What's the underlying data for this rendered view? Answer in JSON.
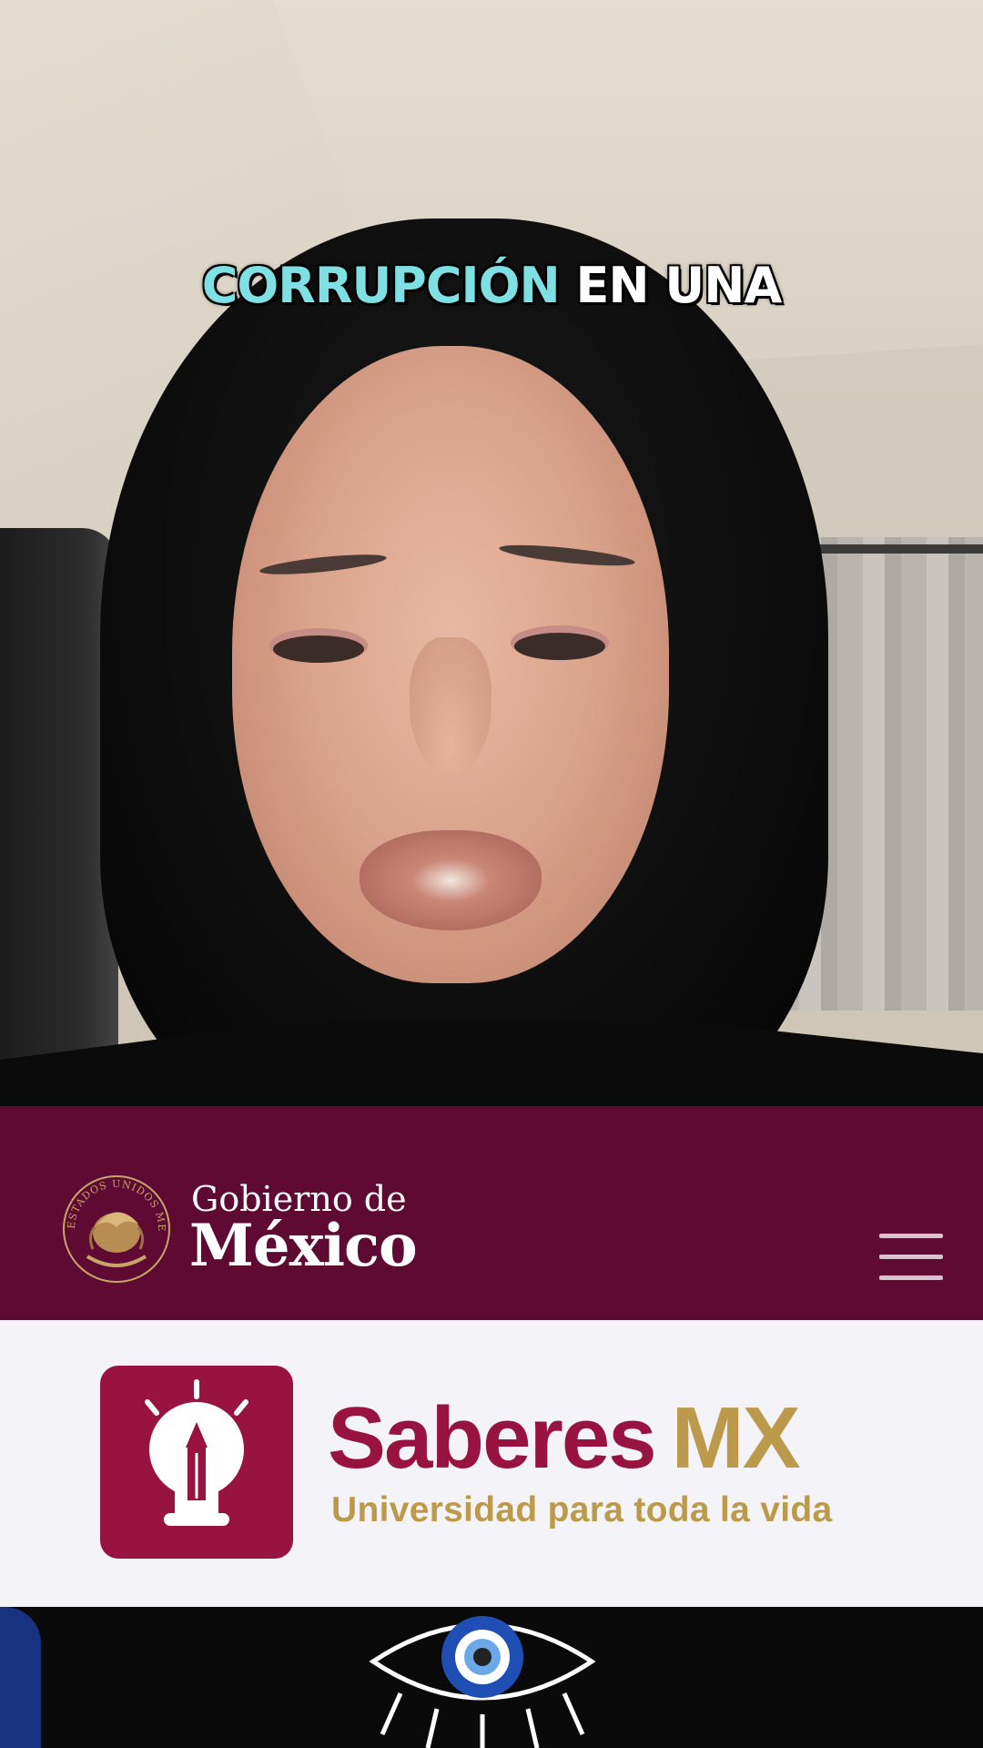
{
  "caption": {
    "highlight": "CORRUPCIÓN",
    "rest": "EN UNA",
    "highlight_color": "#7fe0e4"
  },
  "gov_header": {
    "line1": "Gobierno de",
    "line2": "México",
    "seal_text": "ESTADOS UNIDOS MEXICANOS",
    "background": "#5e0a32",
    "menu_icon": "hamburger-menu-icon"
  },
  "saberes": {
    "title_part1": "Saberes",
    "title_part2": "MX",
    "subtitle": "Universidad para toda la vida",
    "logo_icon": "lightbulb-pencil-icon",
    "primary_color": "#98133f",
    "gold_color": "#bc9a4c"
  }
}
